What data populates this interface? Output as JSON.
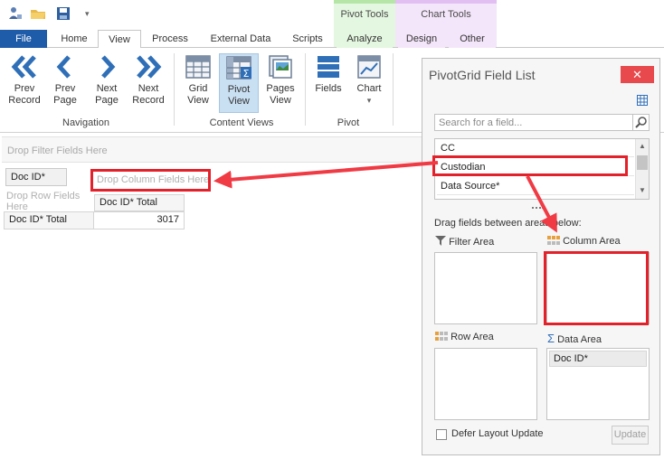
{
  "context_tabs": {
    "pivot_tools": "Pivot Tools",
    "chart_tools": "Chart Tools"
  },
  "tabs": [
    {
      "label": "File"
    },
    {
      "label": "Home"
    },
    {
      "label": "View"
    },
    {
      "label": "Process"
    },
    {
      "label": "External Data"
    },
    {
      "label": "Scripts"
    },
    {
      "label": "Analyze"
    },
    {
      "label": "Design"
    },
    {
      "label": "Other"
    }
  ],
  "ribbon": {
    "navigation": {
      "label": "Navigation",
      "buttons": [
        {
          "line1": "Prev",
          "line2": "Record"
        },
        {
          "line1": "Prev",
          "line2": "Page"
        },
        {
          "line1": "Next",
          "line2": "Page"
        },
        {
          "line1": "Next",
          "line2": "Record"
        }
      ]
    },
    "content_views": {
      "label": "Content Views",
      "buttons": [
        {
          "line1": "Grid",
          "line2": "View"
        },
        {
          "line1": "Pivot",
          "line2": "View"
        },
        {
          "line1": "Pages",
          "line2": "View"
        }
      ]
    },
    "pivot": {
      "label": "Pivot",
      "buttons": [
        {
          "line1": "Fields",
          "line2": ""
        },
        {
          "line1": "Chart",
          "line2": "▾"
        }
      ]
    }
  },
  "pivot_grid": {
    "drop_filter": "Drop Filter Fields Here",
    "row_field": "Doc ID*",
    "drop_column": "Drop Column Fields Here",
    "drop_row_line1": "Drop Row Fields",
    "drop_row_line2": "Here",
    "column_total_header": "Doc ID* Total",
    "row_total_header": "Doc ID* Total",
    "total_value": "3017"
  },
  "field_list": {
    "title": "PivotGrid Field List",
    "close": "✕",
    "search_placeholder": "Search for a field...",
    "fields": [
      "CC",
      "Custodian",
      "Data Source*"
    ],
    "hint": "Drag fields between areas below:",
    "areas": {
      "filter": {
        "label": "Filter Area",
        "items": []
      },
      "column": {
        "label": "Column Area",
        "items": []
      },
      "row": {
        "label": "Row Area",
        "items": []
      },
      "data": {
        "label": "Data Area",
        "items": [
          "Doc ID*"
        ]
      }
    },
    "defer_label": "Defer Layout Update",
    "update_label": "Update"
  },
  "colors": {
    "file_tab": "#1e5ba8",
    "ribbon_icon_blue": "#2f6fb7",
    "highlight_red": "#e3212a",
    "pivot_tools_bg": "#e4f7e0",
    "chart_tools_bg": "#f4e6fa",
    "close_button": "#e8494c"
  }
}
